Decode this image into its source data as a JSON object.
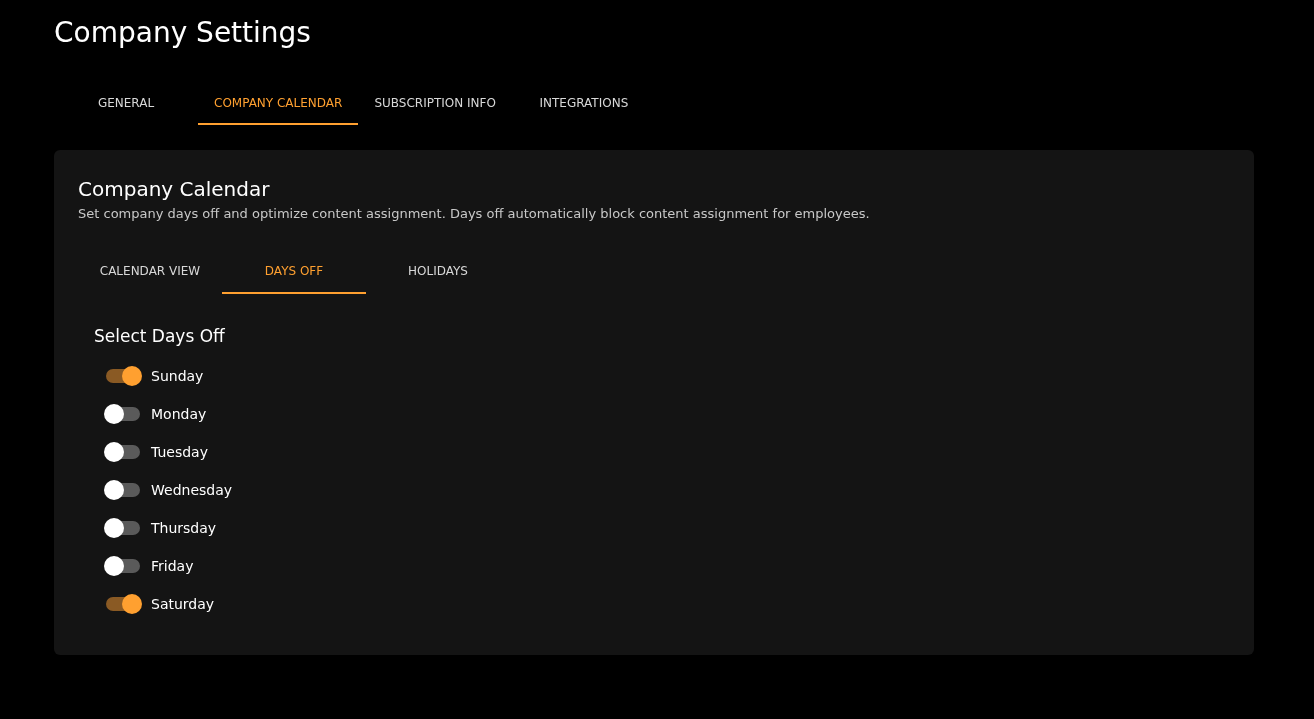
{
  "page_title": "Company Settings",
  "tabs": [
    {
      "label": "GENERAL",
      "selected": false
    },
    {
      "label": "COMPANY CALENDAR",
      "selected": true
    },
    {
      "label": "SUBSCRIPTION INFO",
      "selected": false
    },
    {
      "label": "INTEGRATIONS",
      "selected": false
    }
  ],
  "card": {
    "title": "Company Calendar",
    "description": "Set company days off and optimize content assignment. Days off automatically block content assignment for employees.",
    "tabs": [
      {
        "label": "CALENDAR VIEW",
        "selected": false
      },
      {
        "label": "DAYS OFF",
        "selected": true
      },
      {
        "label": "HOLIDAYS",
        "selected": false
      }
    ],
    "section_title": "Select Days Off",
    "days": [
      {
        "label": "Sunday",
        "on": true
      },
      {
        "label": "Monday",
        "on": false
      },
      {
        "label": "Tuesday",
        "on": false
      },
      {
        "label": "Wednesday",
        "on": false
      },
      {
        "label": "Thursday",
        "on": false
      },
      {
        "label": "Friday",
        "on": false
      },
      {
        "label": "Saturday",
        "on": true
      }
    ]
  }
}
